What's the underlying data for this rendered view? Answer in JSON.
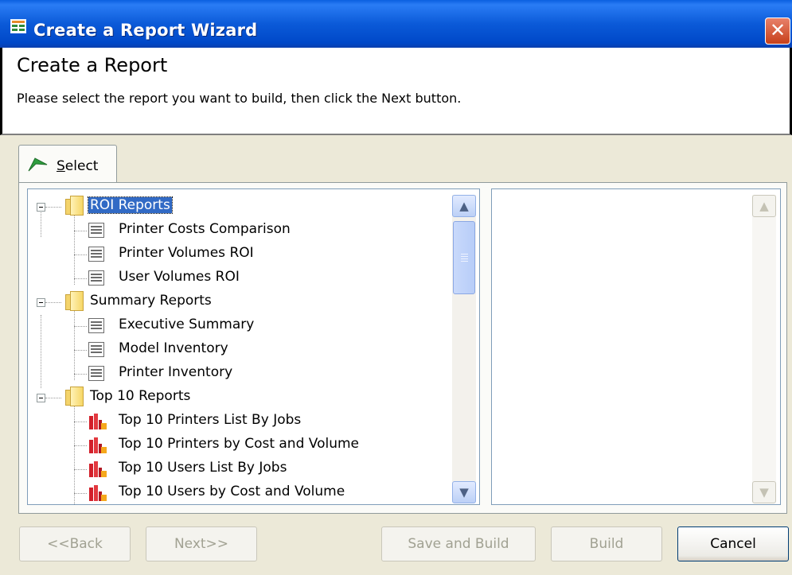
{
  "window": {
    "title": "Create a Report Wizard",
    "close_symbol": "✕"
  },
  "header": {
    "title": "Create a Report",
    "subtitle": "Please select the report you want to build, then click the Next button."
  },
  "tab": {
    "label_prefix": "",
    "label_accel": "S",
    "label_rest": "elect"
  },
  "tree": {
    "groups": [
      {
        "label": "ROI Reports",
        "selected": true,
        "items": [
          "Printer Costs Comparison",
          "Printer Volumes ROI",
          "User Volumes ROI"
        ]
      },
      {
        "label": "Summary Reports",
        "selected": false,
        "items": [
          "Executive Summary",
          "Model Inventory",
          "Printer Inventory"
        ]
      },
      {
        "label": "Top 10 Reports",
        "selected": false,
        "items": [
          "Top 10 Printers List By Jobs",
          "Top 10 Printers by Cost and Volume",
          "Top 10 Users List By Jobs",
          "Top 10 Users by Cost and Volume"
        ]
      }
    ]
  },
  "scroll": {
    "up": "▲",
    "down": "▼"
  },
  "buttons": {
    "back": "<<Back",
    "next": "Next>>",
    "save_build": "Save and Build",
    "build": "Build",
    "cancel": "Cancel"
  },
  "colors": {
    "title_bar": "#0a5fe0",
    "selection": "#316ac5",
    "dialog_bg": "#ece9d8"
  }
}
